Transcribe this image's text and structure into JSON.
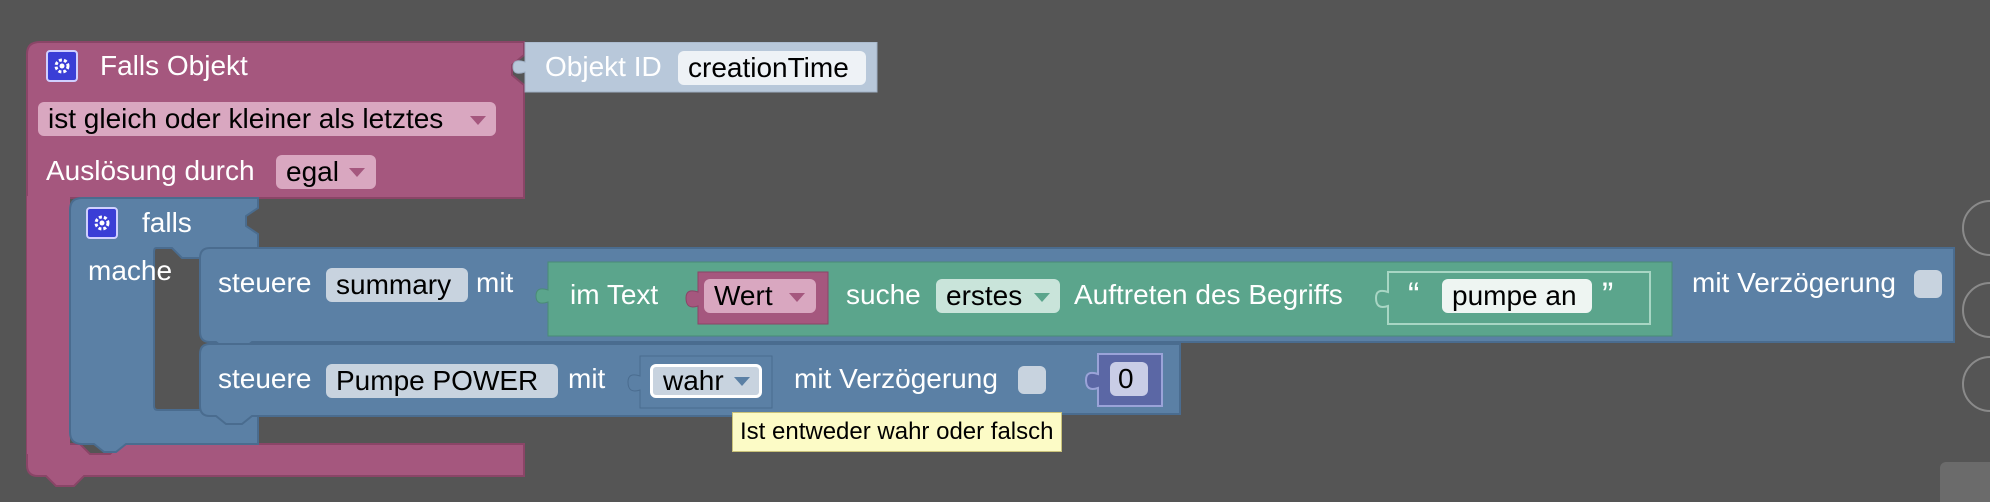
{
  "colors": {
    "background": "#555555",
    "event_block": "#a5577e",
    "control_block": "#5b80a5",
    "text_block": "#5ba58c",
    "object_id_block": "#b8c8da",
    "number_block": "#5b67a5",
    "tooltip": "#fcfbc6"
  },
  "trigger": {
    "title": "Falls Objekt",
    "condition_option": "ist gleich oder kleiner als letztes",
    "trigger_label": "Auslösung durch",
    "trigger_option": "egal",
    "object_id_label": "Objekt ID",
    "object_id_value": "creationTime"
  },
  "if_block": {
    "if_label": "falls",
    "do_label": "mache"
  },
  "control1": {
    "label": "steuere",
    "target": "summary",
    "with_label": "mit",
    "text_in_label": "im Text",
    "variable": "Wert",
    "find_label": "suche",
    "occurrence_option": "erstes",
    "occurrence_suffix": "Auftreten des Begriffs",
    "quote_open": "“",
    "search_text": "pumpe an",
    "quote_close": "”",
    "delay_label": "mit Verzögerung"
  },
  "control2": {
    "label": "steuere",
    "target": "Pumpe POWER",
    "with_label": "mit",
    "bool_option": "wahr",
    "delay_label": "mit Verzögerung",
    "number_value": "0"
  },
  "tooltip": {
    "text": "Ist entweder wahr oder falsch"
  }
}
